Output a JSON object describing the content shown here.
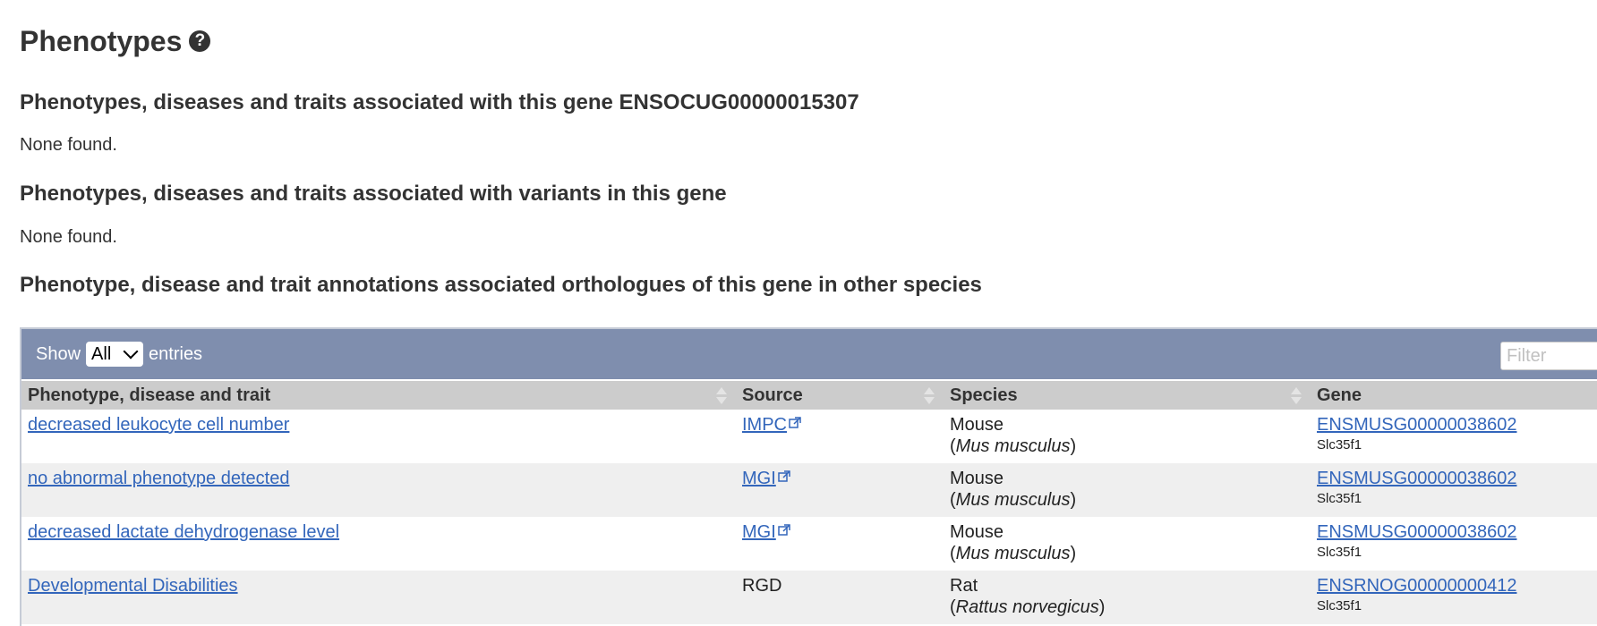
{
  "page_title": "Phenotypes",
  "help_icon_glyph": "?",
  "sections": {
    "gene": {
      "heading": "Phenotypes, diseases and traits associated with this gene ENSOCUG00000015307",
      "body": "None found."
    },
    "variants": {
      "heading": "Phenotypes, diseases and traits associated with variants in this gene",
      "body": "None found."
    },
    "orthologues": {
      "heading": "Phenotype, disease and trait annotations associated orthologues of this gene in other species"
    }
  },
  "table": {
    "show_label": "Show",
    "entries_label": "entries",
    "entries_selected": "All",
    "filter_placeholder": "Filter",
    "columns": {
      "phenotype": "Phenotype, disease and trait",
      "source": "Source",
      "species": "Species",
      "gene": "Gene"
    },
    "rows": [
      {
        "phenotype": "decreased leukocyte cell number",
        "source": "IMPC",
        "source_external": true,
        "species_common": "Mouse",
        "species_open": "(",
        "species_sci": "Mus musculus",
        "species_close": ")",
        "gene_id": "ENSMUSG00000038602",
        "gene_symbol": "Slc35f1"
      },
      {
        "phenotype": "no abnormal phenotype detected",
        "source": "MGI",
        "source_external": true,
        "species_common": "Mouse",
        "species_open": "(",
        "species_sci": "Mus musculus",
        "species_close": ")",
        "gene_id": "ENSMUSG00000038602",
        "gene_symbol": "Slc35f1"
      },
      {
        "phenotype": "decreased lactate dehydrogenase level",
        "source": "MGI",
        "source_external": true,
        "species_common": "Mouse",
        "species_open": "(",
        "species_sci": "Mus musculus",
        "species_close": ")",
        "gene_id": "ENSMUSG00000038602",
        "gene_symbol": "Slc35f1"
      },
      {
        "phenotype": "Developmental Disabilities",
        "source": "RGD",
        "source_external": false,
        "species_common": "Rat",
        "species_open": "(",
        "species_sci": "Rattus norvegicus",
        "species_close": ")",
        "gene_id": "ENSRNOG00000000412",
        "gene_symbol": "Slc35f1"
      }
    ]
  },
  "colors": {
    "toolbar_bg": "#7f8eae",
    "header_bg": "#cccccc",
    "link": "#3366bb",
    "row_alt": "#efefef"
  }
}
